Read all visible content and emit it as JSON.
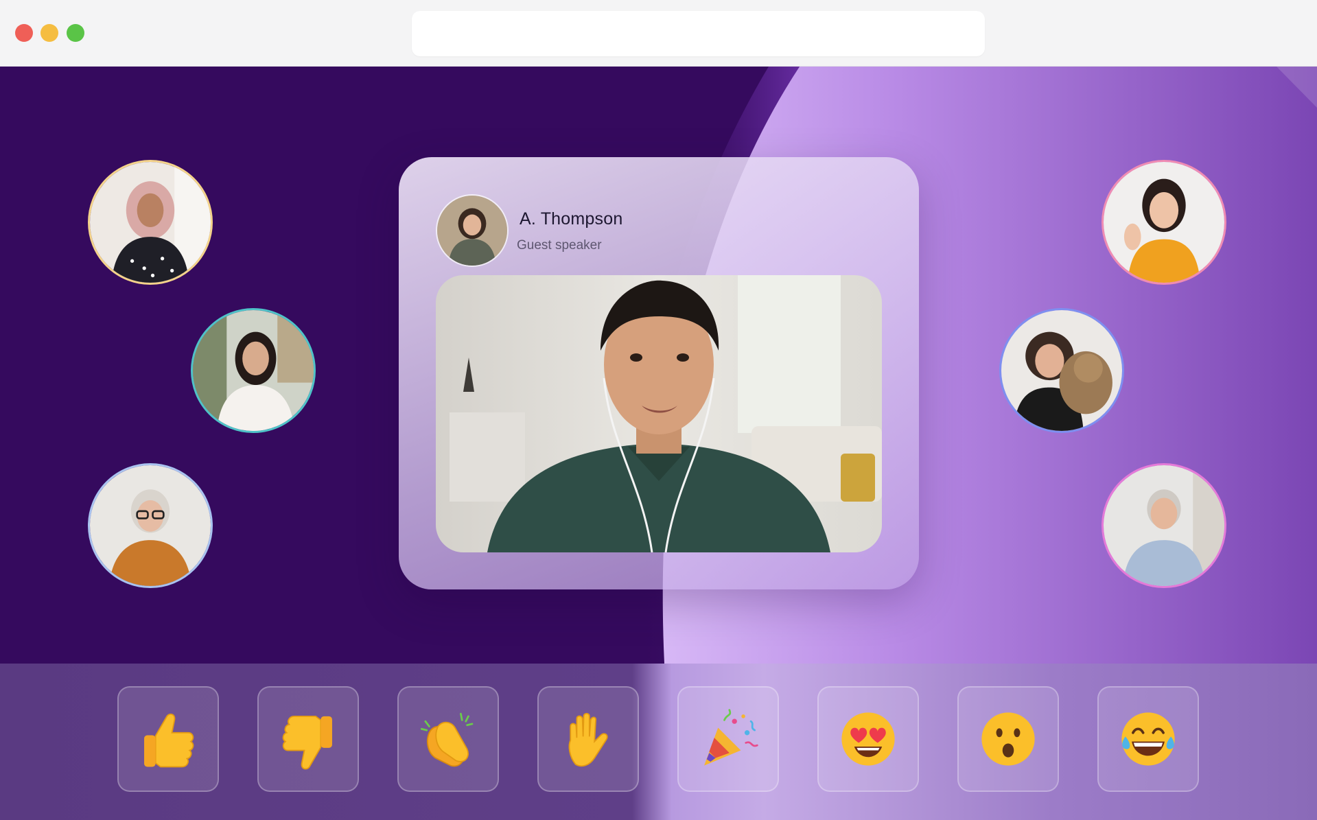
{
  "window": {
    "address_value": "",
    "controls": [
      "close",
      "minimize",
      "maximize"
    ]
  },
  "speaker": {
    "name": "A. Thompson",
    "role": "Guest speaker"
  },
  "participants": [
    {
      "id": "p1",
      "ring": "#f4d38a"
    },
    {
      "id": "p2",
      "ring": "#4fc3c8"
    },
    {
      "id": "p3",
      "ring": "#a9c3f0"
    },
    {
      "id": "p4",
      "ring": "#f08cb3"
    },
    {
      "id": "p5",
      "ring": "#7e8ff0"
    },
    {
      "id": "p6",
      "ring": "#e57ad8"
    }
  ],
  "reactions": [
    {
      "name": "thumbs-up",
      "icon": "thumbs-up-icon"
    },
    {
      "name": "thumbs-down",
      "icon": "thumbs-down-icon"
    },
    {
      "name": "clapping",
      "icon": "clapping-hands-icon"
    },
    {
      "name": "raised-hand",
      "icon": "raised-hand-icon"
    },
    {
      "name": "party-popper",
      "icon": "party-popper-icon"
    },
    {
      "name": "heart-eyes",
      "icon": "heart-eyes-icon"
    },
    {
      "name": "surprised",
      "icon": "surprised-face-icon"
    },
    {
      "name": "laughing",
      "icon": "tears-of-joy-icon"
    }
  ],
  "colors": {
    "stage_dark": "#350a5e",
    "stage_light": "#c9a6f0",
    "emoji_yellow": "#fbbf2a"
  }
}
